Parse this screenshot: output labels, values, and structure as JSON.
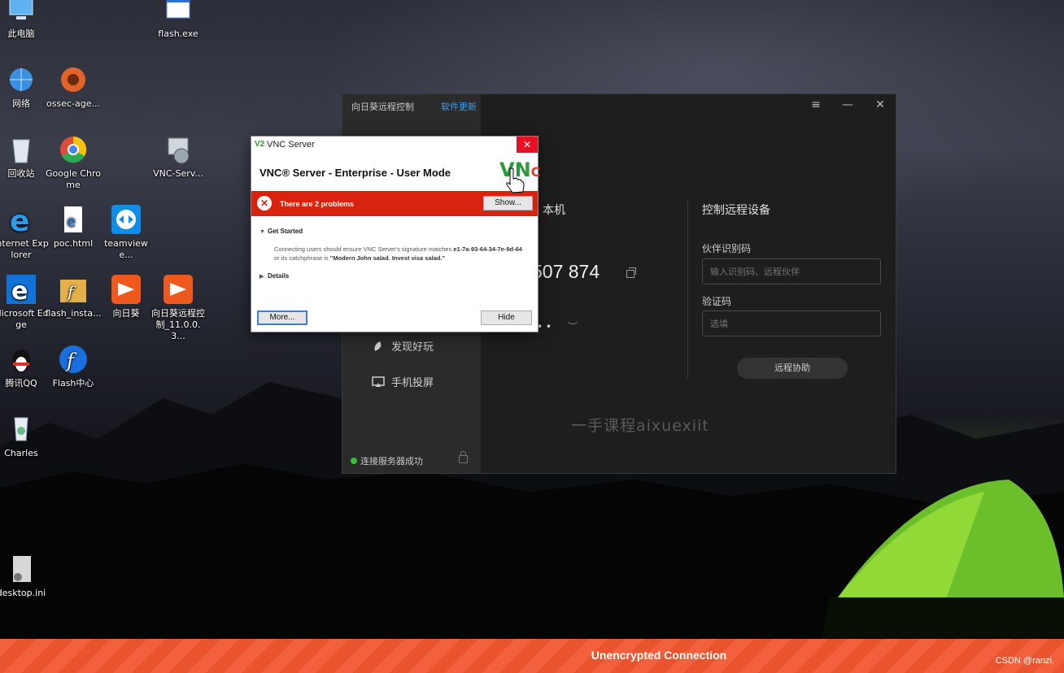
{
  "desktop": {
    "icons": [
      {
        "label": "此电脑",
        "icon": "computer-icon"
      },
      {
        "label": "flash.exe",
        "icon": "exe-window-icon"
      },
      {
        "label": "网络",
        "icon": "network-icon"
      },
      {
        "label": "ossec-age...",
        "icon": "ossec-icon"
      },
      {
        "label": "回收站",
        "icon": "recycle-bin-icon"
      },
      {
        "label": "Google Chrome",
        "icon": "chrome-icon"
      },
      {
        "label": "VNC-Serv...",
        "icon": "vnc-installer-icon"
      },
      {
        "label": "Internet Explorer",
        "icon": "ie-icon"
      },
      {
        "label": "poc.html",
        "icon": "html-file-icon"
      },
      {
        "label": "teamviewe...",
        "icon": "teamviewer-icon"
      },
      {
        "label": "Microsoft Edge",
        "icon": "edge-icon"
      },
      {
        "label": "flash_insta...",
        "icon": "flash-installer-icon"
      },
      {
        "label": "向日葵",
        "icon": "sunlogin-icon"
      },
      {
        "label": "向日葵远程控制_11.0.0.3...",
        "icon": "sunlogin-installer-icon"
      },
      {
        "label": "腾讯QQ",
        "icon": "qq-icon"
      },
      {
        "label": "Flash中心",
        "icon": "flash-center-icon"
      },
      {
        "label": "Charles",
        "icon": "charles-icon"
      },
      {
        "label": "desktop.ini",
        "icon": "ini-file-icon"
      }
    ]
  },
  "sunlogin": {
    "title": "向日葵远程控制",
    "update_link": "软件更新",
    "menu": [
      "发现好玩",
      "手机投屏"
    ],
    "connection_status": "连接服务器成功",
    "local_heading": "本机",
    "device_code": "507 874",
    "password_mask": "• •",
    "remote_heading": "控制远程设备",
    "partner_label": "伙伴识别码",
    "partner_placeholder": "输入识别码、远程伙伴",
    "verify_label": "验证码",
    "verify_placeholder": "选填",
    "assist_button": "远程协助",
    "watermark": "一手课程aixuexiit"
  },
  "vnc_dialog": {
    "window_title": "VNC Server",
    "title_icon": "V2",
    "close_glyph": "✕",
    "heading": "VNC® Server - Enterprise - User Mode",
    "logo_main": "VN",
    "logo_accent": "C",
    "problem_text": "There are 2 problems",
    "problem_icon": "✕",
    "show_button": "Show...",
    "section1": "Get Started",
    "message_pre": "Connecting users should ensure VNC Server's signature matches ",
    "signature": "e1-7a-93-64-34-7e-9d-64",
    "message_mid": " or its catchphrase is ",
    "catchphrase": "\"Modern John salad. Invest visa salad.\"",
    "section2": "Details",
    "more_button": "More...",
    "hide_button": "Hide"
  },
  "status_bar": {
    "text": "Unencrypted Connection",
    "watermark": "CSDN @ranzi."
  },
  "colors": {
    "status_orange": "#f2603d",
    "vnc_error_red": "#d9230f",
    "sunlogin_link_blue": "#3f9cf1",
    "connected_green": "#3dbb3d"
  }
}
